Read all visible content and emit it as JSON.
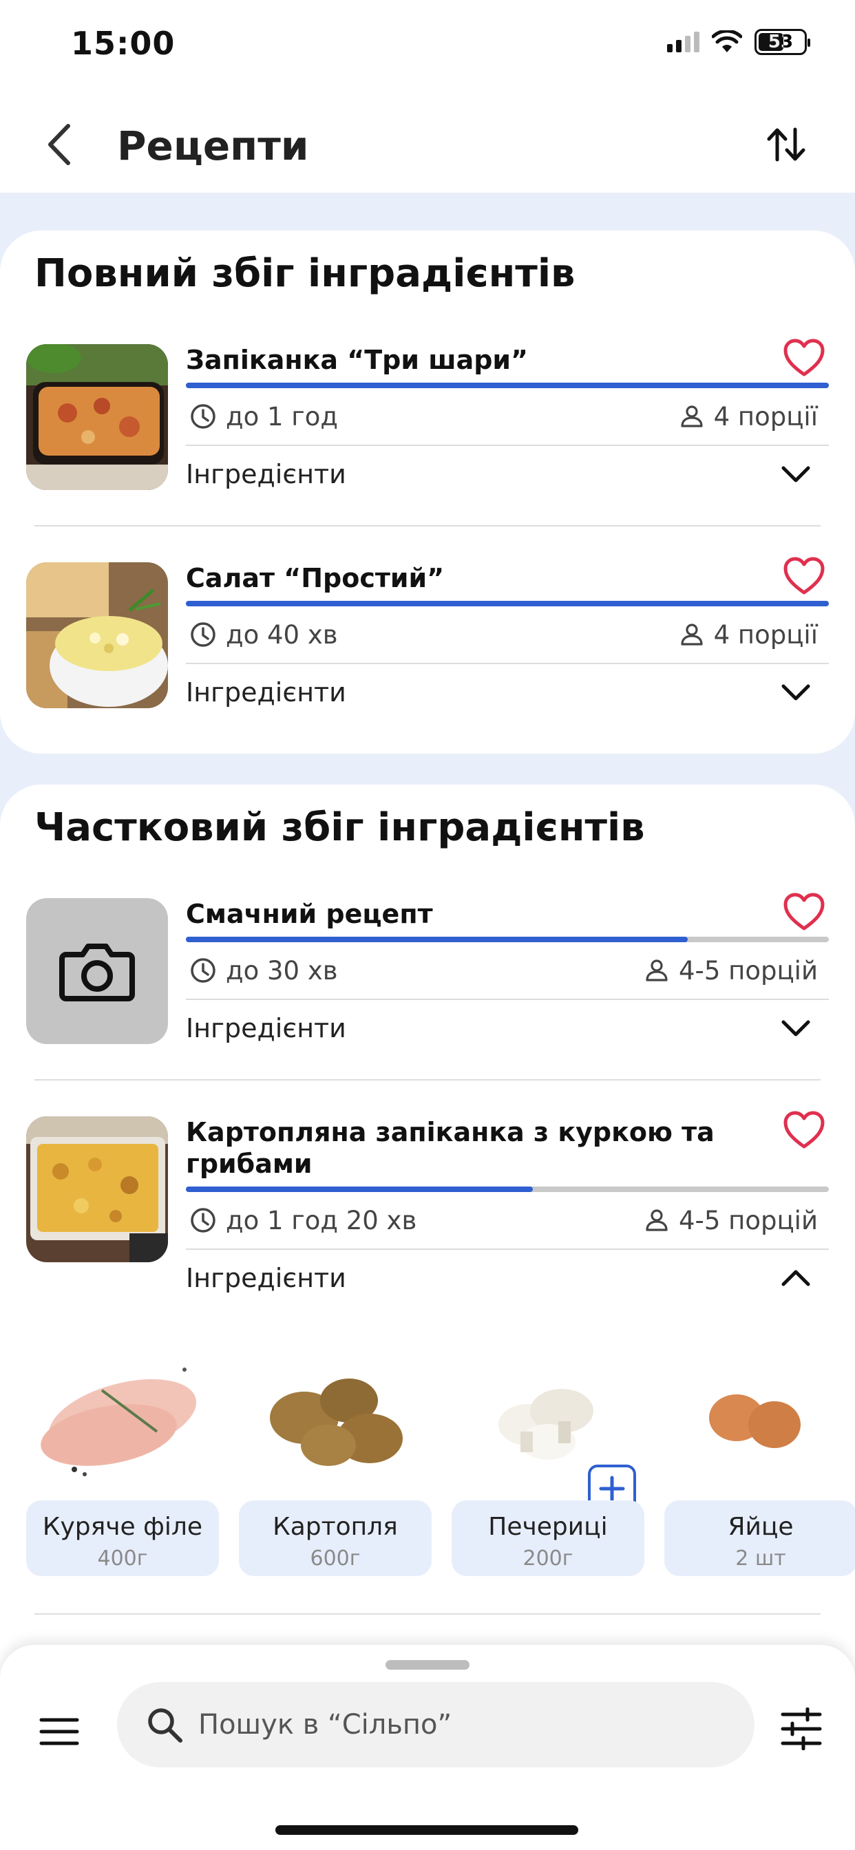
{
  "status_bar": {
    "time": "15:00",
    "battery": "53"
  },
  "header": {
    "title": "Рецепти",
    "back_icon": "chevron-left-icon",
    "sort_icon": "sort-arrows-icon"
  },
  "sections": [
    {
      "title": "Повний збіг інградієнтів",
      "recipes": [
        {
          "title": "Запіканка “Три шари”",
          "time": "до 1 год",
          "portions": "4 порції",
          "ingredients_label": "Інгредієнти",
          "match_fraction": 1.0,
          "expanded": false
        },
        {
          "title": "Салат “Простий”",
          "time": "до 40 хв",
          "portions": "4 порції",
          "ingredients_label": "Інгредієнти",
          "match_fraction": 1.0,
          "expanded": false
        }
      ]
    },
    {
      "title": "Частковий збіг інградієнтів",
      "recipes": [
        {
          "title": "Смачний рецепт",
          "time": "до 30 хв",
          "portions": "4-5 порцій",
          "ingredients_label": "Інгредієнти",
          "match_fraction": 0.78,
          "expanded": false
        },
        {
          "title": "Картопляна запіканка з куркою та грибами",
          "time": "до 1 год 20 хв",
          "portions": "4-5 порцій",
          "ingredients_label": "Інгредієнти",
          "match_fraction": 0.54,
          "expanded": true,
          "ingredients": [
            {
              "name": "Куряче філе",
              "qty": "400г"
            },
            {
              "name": "Картопля",
              "qty": "600г"
            },
            {
              "name": "Печериці",
              "qty": "200г",
              "add_button": true
            },
            {
              "name": "Яйце",
              "qty": "2 шт"
            }
          ]
        }
      ]
    }
  ],
  "bottom_bar": {
    "search_placeholder": "Пошук в “Сільпо”"
  },
  "colors": {
    "accent": "#2f5fd0",
    "heart": "#e0304f",
    "background": "#e9effa"
  }
}
